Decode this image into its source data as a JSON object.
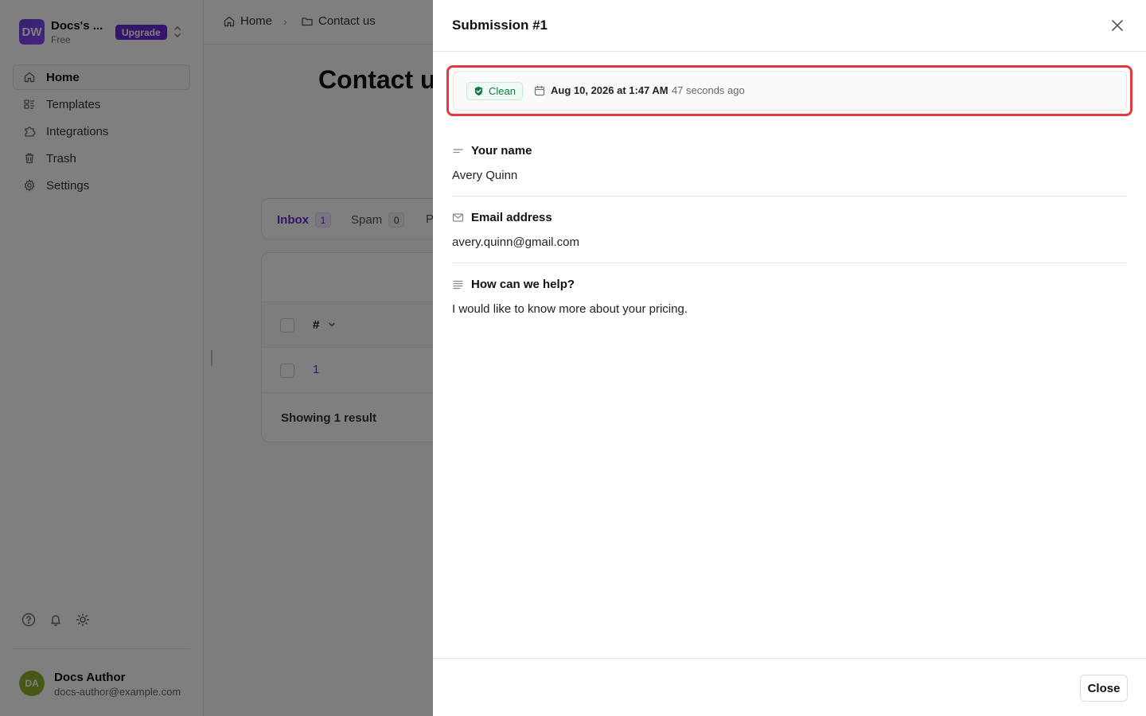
{
  "workspace": {
    "initials": "DW",
    "name": "Docs's ...",
    "plan": "Free",
    "upgrade_label": "Upgrade"
  },
  "sidebar": {
    "items": [
      {
        "label": "Home",
        "icon": "home-icon",
        "active": true
      },
      {
        "label": "Templates",
        "icon": "templates-icon"
      },
      {
        "label": "Integrations",
        "icon": "puzzle-icon"
      },
      {
        "label": "Trash",
        "icon": "trash-icon"
      },
      {
        "label": "Settings",
        "icon": "gear-icon"
      }
    ],
    "tools": [
      "help-icon",
      "bell-icon",
      "sun-icon"
    ]
  },
  "user": {
    "initials": "DA",
    "name": "Docs Author",
    "email": "docs-author@example.com"
  },
  "breadcrumb": {
    "home": "Home",
    "current": "Contact us"
  },
  "main": {
    "title": "Contact us",
    "tabs": [
      {
        "label": "Inbox",
        "count": "1",
        "active": true
      },
      {
        "label": "Spam",
        "count": "0"
      },
      {
        "label": "P"
      }
    ],
    "table": {
      "col_hash": "#",
      "rows": [
        {
          "number": "1"
        }
      ],
      "footer": "Showing 1 result"
    }
  },
  "drawer": {
    "title": "Submission #1",
    "status": "Clean",
    "date": "Aug 10, 2026 at 1:47 AM",
    "ago": "· 47 seconds ago",
    "fields": [
      {
        "label": "Your name",
        "icon": "short-text-icon",
        "value": "Avery Quinn"
      },
      {
        "label": "Email address",
        "icon": "mail-icon",
        "value": "avery.quinn@gmail.com"
      },
      {
        "label": "How can we help?",
        "icon": "long-text-icon",
        "value": "I would like to know more about your pricing."
      }
    ],
    "close_label": "Close"
  },
  "colors": {
    "accent": "#6b2bd9",
    "highlight": "#e5393f",
    "clean_green": "#147a45"
  }
}
